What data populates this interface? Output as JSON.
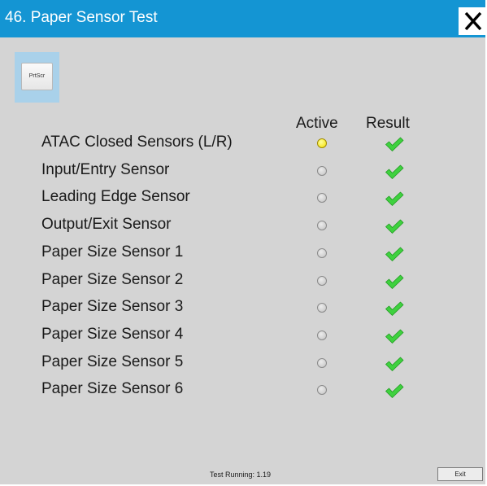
{
  "window": {
    "title": "46. Paper Sensor Test",
    "close_icon": "close-icon"
  },
  "toolbar": {
    "prtscr_label": "PrtScr"
  },
  "table": {
    "headers": {
      "active": "Active",
      "result": "Result"
    },
    "rows": [
      {
        "label": "ATAC Closed Sensors (L/R)",
        "active": true,
        "result": "pass"
      },
      {
        "label": "Input/Entry Sensor",
        "active": false,
        "result": "pass"
      },
      {
        "label": "Leading Edge Sensor",
        "active": false,
        "result": "pass"
      },
      {
        "label": "Output/Exit Sensor",
        "active": false,
        "result": "pass"
      },
      {
        "label": "Paper Size Sensor 1",
        "active": false,
        "result": "pass"
      },
      {
        "label": "Paper Size Sensor 2",
        "active": false,
        "result": "pass"
      },
      {
        "label": "Paper Size Sensor 3",
        "active": false,
        "result": "pass"
      },
      {
        "label": "Paper Size Sensor 4",
        "active": false,
        "result": "pass"
      },
      {
        "label": "Paper Size Sensor 5",
        "active": false,
        "result": "pass"
      },
      {
        "label": "Paper Size Sensor 6",
        "active": false,
        "result": "pass"
      }
    ]
  },
  "footer": {
    "status": "Test Running: 1.19",
    "exit_label": "Exit"
  },
  "colors": {
    "titlebar": "#1495d3",
    "background": "#d4d4d4",
    "active_on": "#f5e100",
    "check_green": "#3fd13f"
  }
}
